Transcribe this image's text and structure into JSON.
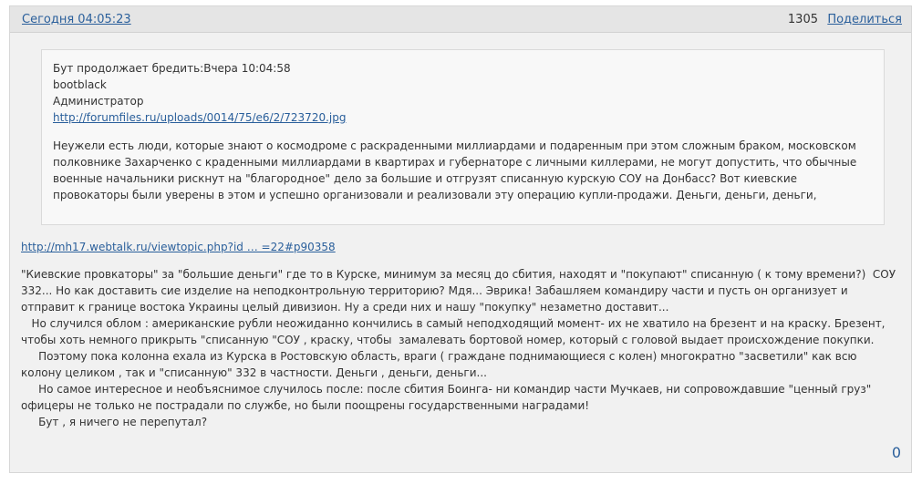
{
  "header": {
    "post_time": "Сегодня 04:05:23",
    "post_number": "1305",
    "share_label": "Поделиться"
  },
  "quote": {
    "title": "Бут продолжает бредить:Вчера 10:04:58",
    "author": "bootblack",
    "role": "Администратор",
    "link": "http://forumfiles.ru/uploads/0014/75/e6/2/723720.jpg",
    "text": "Неужели есть люди, которые знают о космодроме с раскраденными миллиардами и подаренным при этом сложным браком, московском полковнике Захарченко с краденными миллиардами в квартирах и губернаторе с личными киллерами, не могут допустить, что обычные военные начальники рискнут на \"благородное\" дело за большие и отгрузят списанную курскую СОУ на Донбасс? Вот киевские провокаторы были уверены в этом и успешно организовали и реализовали эту операцию купли-продажи. Деньги, деньги, деньги,"
  },
  "body": {
    "link": "http://mh17.webtalk.ru/viewtopic.php?id … =22#p90358",
    "text": "\"Киевские провкаторы\" за \"большие деньги\" где то в Курске, минимум за месяц до сбития, находят и \"покупают\" списанную ( к тому времени?)  СОУ 332... Но как доставить сие изделие на неподконтрольную территорию? Мдя... Эврика! Забашляем командиру части и пусть он организует и отправит к границе востока Украины целый дивизион. Ну а среди них и нашу \"покупку\" незаметно доставит...\n   Но случился облом : американские рубли неожиданно кончились в самый неподходящий момент- их не хватило на брезент и на краску. Брезент, чтобы хоть немного прикрыть \"списанную \"СОУ , краску, чтобы  замалевать бортовой номер, который с головой выдает происхождение покупки.\n     Поэтому пока колонна ехала из Курска в Ростовскую область, враги ( граждане поднимающиеся с колен) многократно \"засветили\" как всю колону целиком , так и \"списанную\" 332 в частности. Деньги , деньги, деньги...\n     Но самое интересное и необъяснимое случилось после: после сбития Боинга- ни командир части Мучкаев, ни сопровождавшие \"ценный груз\" офицеры не только не пострадали по службе, но были поощрены государственными наградами!\n     Бут , я ничего не перепутал?"
  },
  "footer": {
    "likes_count": "0"
  },
  "colors": {
    "link": "#2a5f9b",
    "background": "#f1f1f1",
    "header": "#e5e5e5",
    "quote_background": "#f8f8f8"
  }
}
